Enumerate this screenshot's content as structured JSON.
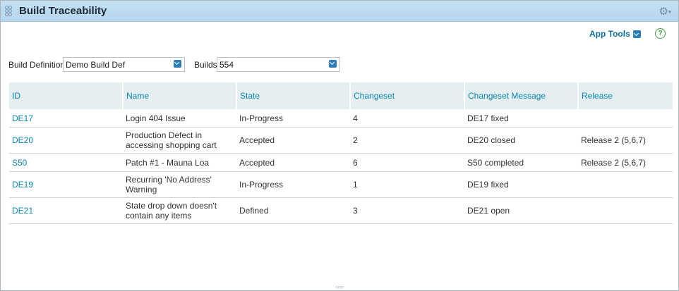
{
  "header": {
    "title": "Build Traceability"
  },
  "toolbar": {
    "app_tools_label": "App Tools",
    "help_label": "?"
  },
  "filters": {
    "build_definition_label": "Build Definition",
    "build_definition_value": "Demo Build Def",
    "builds_label": "Builds",
    "builds_value": "554"
  },
  "table": {
    "columns": [
      "ID",
      "Name",
      "State",
      "Changeset",
      "Changeset Message",
      "Release"
    ],
    "rows": [
      {
        "id": "DE17",
        "name": "Login 404 Issue",
        "state": "In-Progress",
        "changeset": "4",
        "message": "DE17 fixed",
        "release": ""
      },
      {
        "id": "DE20",
        "name": "Production Defect in accessing shopping cart",
        "state": "Accepted",
        "changeset": "2",
        "message": "DE20 closed",
        "release": "Release 2 (5,6,7)"
      },
      {
        "id": "S50",
        "name": "Patch #1 - Mauna Loa",
        "state": "Accepted",
        "changeset": "6",
        "message": "S50 completed",
        "release": "Release 2 (5,6,7)"
      },
      {
        "id": "DE19",
        "name": "Recurring 'No Address' Warning",
        "state": "In-Progress",
        "changeset": "1",
        "message": "DE19 fixed",
        "release": ""
      },
      {
        "id": "DE21",
        "name": "State drop down doesn't contain any items",
        "state": "Defined",
        "changeset": "3",
        "message": "DE21 open",
        "release": ""
      }
    ]
  },
  "colors": {
    "header_bg": "#c5e0f3",
    "link": "#0b87b1",
    "accent": "#2d7eb6",
    "help": "#3da23d"
  }
}
